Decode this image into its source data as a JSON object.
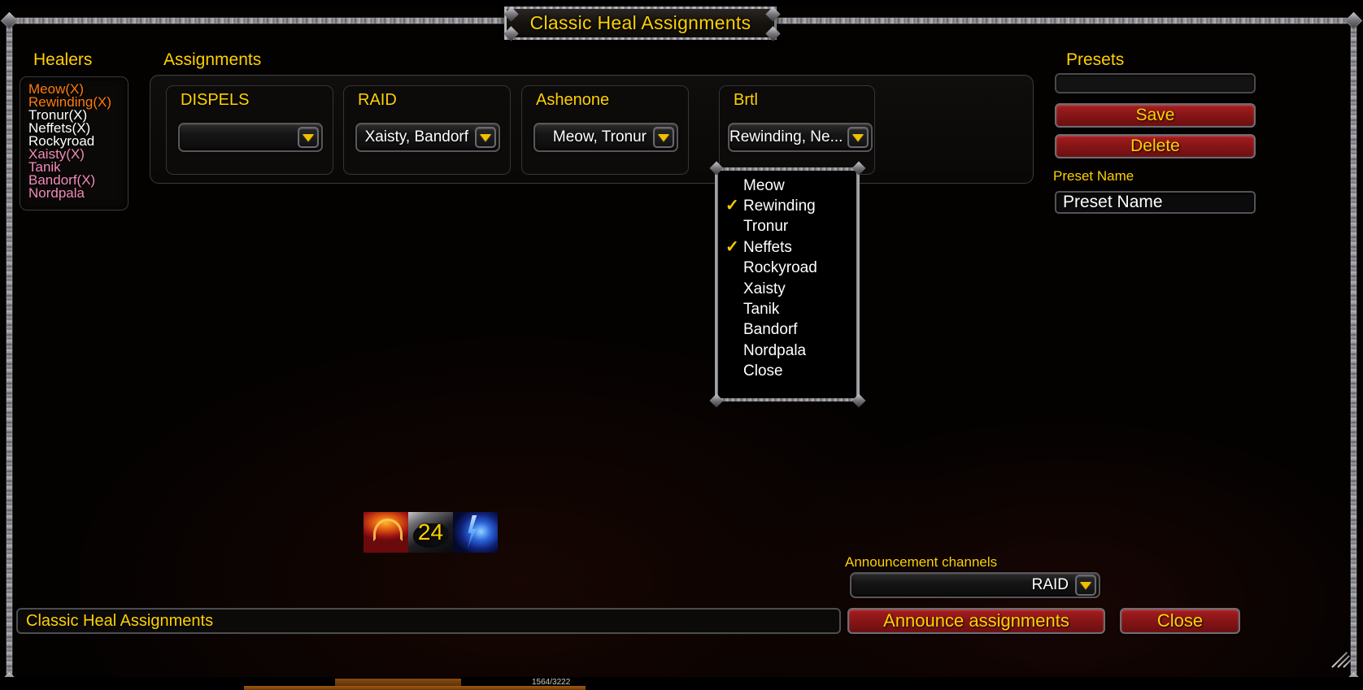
{
  "window": {
    "title": "Classic Heal Assignments"
  },
  "headings": {
    "healers": "Healers",
    "assignments": "Assignments",
    "presets": "Presets"
  },
  "healers": {
    "items": [
      {
        "name": "Meow(X)",
        "color": "#ff7c0a"
      },
      {
        "name": "Rewinding(X)",
        "color": "#ff7c0a"
      },
      {
        "name": "Tronur(X)",
        "color": "#ffffff"
      },
      {
        "name": "Neffets(X)",
        "color": "#ffffff"
      },
      {
        "name": "Rockyroad",
        "color": "#ffffff"
      },
      {
        "name": "Xaisty(X)",
        "color": "#f48cba"
      },
      {
        "name": "Tanik",
        "color": "#f48cba"
      },
      {
        "name": "Bandorf(X)",
        "color": "#f48cba"
      },
      {
        "name": "Nordpala",
        "color": "#f48cba"
      }
    ]
  },
  "assignments": {
    "columns": [
      {
        "label": "DISPELS",
        "value": ""
      },
      {
        "label": "RAID",
        "value": "Xaisty, Bandorf"
      },
      {
        "label": "Ashenone",
        "value": "Meow, Tronur"
      },
      {
        "label": "Brtl",
        "value": "Rewinding, Ne..."
      }
    ]
  },
  "dropdown_menu": {
    "open_for_column": "Brtl",
    "items": [
      {
        "label": "Meow",
        "checked": false
      },
      {
        "label": "Rewinding",
        "checked": true
      },
      {
        "label": "Tronur",
        "checked": false
      },
      {
        "label": "Neffets",
        "checked": true
      },
      {
        "label": "Rockyroad",
        "checked": false
      },
      {
        "label": "Xaisty",
        "checked": false
      },
      {
        "label": "Tanik",
        "checked": false
      },
      {
        "label": "Bandorf",
        "checked": false
      },
      {
        "label": "Nordpala",
        "checked": false
      },
      {
        "label": "Close",
        "checked": false
      }
    ],
    "check_glyph": "✓"
  },
  "presets": {
    "select_value": "",
    "save_label": "Save",
    "delete_label": "Delete",
    "preset_name_label": "Preset Name",
    "preset_name_value": "Preset Name"
  },
  "spell_bar": {
    "cooldown": "24",
    "icons": [
      "fire-spell-icon",
      "shadow-spell-icon",
      "lightning-spell-icon"
    ]
  },
  "announcement": {
    "label": "Announcement channels",
    "channel": "RAID"
  },
  "footer": {
    "status_text": "Classic Heal Assignments",
    "announce_label": "Announce assignments",
    "close_label": "Close"
  },
  "bottom_peek": {
    "text": "1564/3222"
  },
  "colors": {
    "gold": "#ffd100",
    "red_button": "#a61e20",
    "druid_orange": "#ff7c0a",
    "priest_white": "#ffffff",
    "paladin_pink": "#f48cba",
    "arrow_yellow": "#f0c000"
  }
}
